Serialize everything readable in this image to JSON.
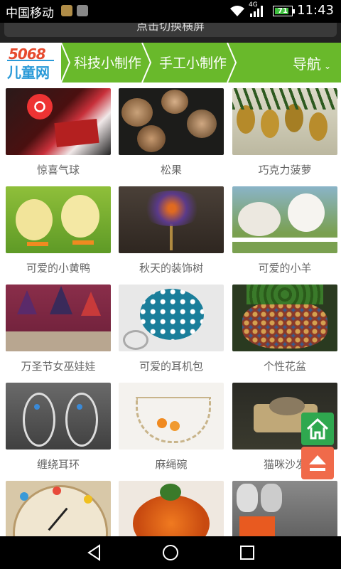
{
  "status": {
    "carrier": "中国移动",
    "network": "4G",
    "battery": "71",
    "time": "11:43"
  },
  "banner": {
    "text": "点击切换横屏"
  },
  "nav": {
    "logo_number": "5068",
    "logo_text": "儿童网",
    "items": [
      "科技小制作",
      "手工小制作"
    ],
    "menu_label": "导航"
  },
  "grid": [
    {
      "caption": "惊喜气球"
    },
    {
      "caption": "松果"
    },
    {
      "caption": "巧克力菠萝"
    },
    {
      "caption": "可爱的小黄鸭"
    },
    {
      "caption": "秋天的装饰树"
    },
    {
      "caption": "可爱的小羊"
    },
    {
      "caption": "万圣节女巫娃娃"
    },
    {
      "caption": "可爱的耳机包"
    },
    {
      "caption": "个性花盆"
    },
    {
      "caption": "缠绕耳环"
    },
    {
      "caption": "麻绳碗"
    },
    {
      "caption": "猫咪沙发"
    }
  ],
  "float": {
    "home_icon": "home-icon",
    "top_icon": "back-to-top-icon"
  },
  "colors": {
    "nav_green": "#69b92b",
    "home_green": "#2fa84f",
    "top_orange": "#f06a4a"
  }
}
